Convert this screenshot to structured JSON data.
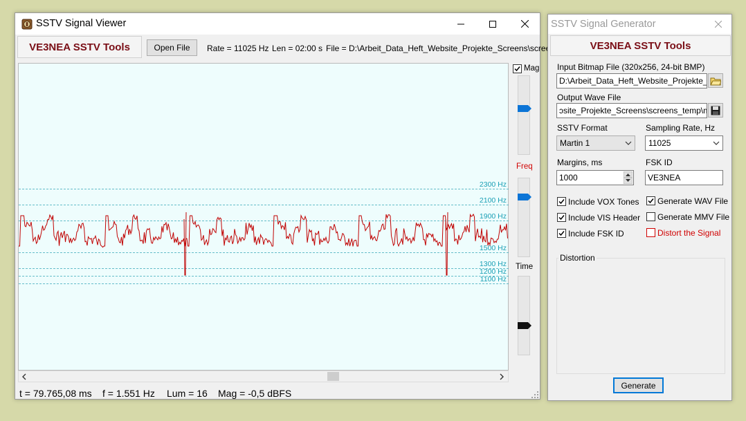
{
  "viewer": {
    "title": "SSTV Signal Viewer",
    "brand": "VE3NEA SSTV Tools",
    "open_file_label": "Open File",
    "rate": "Rate = 11025 Hz",
    "len": "Len = 02:00 s",
    "file": "File = D:\\Arbeit_Data_Heft_Website_Projekte_Screens\\screens_",
    "freq_labels": [
      "2300 Hz",
      "2100 Hz",
      "1900 Hz",
      "1500 Hz",
      "1300 Hz",
      "1200 Hz",
      "1100 Hz"
    ],
    "panel": {
      "mag_label": "Mag",
      "mag_checked": true,
      "freq_label": "Freq",
      "time_label": "Time",
      "mag_level": 0.58,
      "freq_level": 0.76,
      "time_level": 0.37
    },
    "status": {
      "t": "t = 79.765,08 ms",
      "f": "f = 1.551 Hz",
      "lum": "Lum = 16",
      "mag": "Mag = -0,5 dBFS"
    },
    "colors": {
      "plot_bg": "#eefdfd",
      "signal": "#c00000",
      "grid": "#36a6b8",
      "freq_label": "#1a9fb5",
      "brand": "#7a0e16"
    }
  },
  "generator": {
    "title": "SSTV Signal Generator",
    "brand": "VE3NEA SSTV Tools",
    "input_label": "Input Bitmap File (320x256, 24-bit BMP)",
    "input_value": "D:\\Arbeit_Data_Heft_Website_Projekte_Scr",
    "output_label": "Output Wave File",
    "output_value": "ɔsite_Projekte_Screens\\screens_temp\\moi.v",
    "format_label": "SSTV Format",
    "format_value": "Martin 1",
    "rate_label": "Sampling Rate, Hz",
    "rate_value": "11025",
    "margins_label": "Margins, ms",
    "margins_value": "1000",
    "fsk_label": "FSK ID",
    "fsk_value": "VE3NEA",
    "checkboxes_left": [
      {
        "label": "Include VOX Tones",
        "checked": true
      },
      {
        "label": "Include VIS Header",
        "checked": true
      },
      {
        "label": "Include FSK ID",
        "checked": true
      }
    ],
    "checkboxes_right": [
      {
        "label": "Generate WAV File",
        "checked": true
      },
      {
        "label": "Generate MMV File",
        "checked": false
      },
      {
        "label": "Distort the Signal",
        "checked": false
      }
    ],
    "distortion_label": "Distortion",
    "generate_label": "Generate"
  }
}
